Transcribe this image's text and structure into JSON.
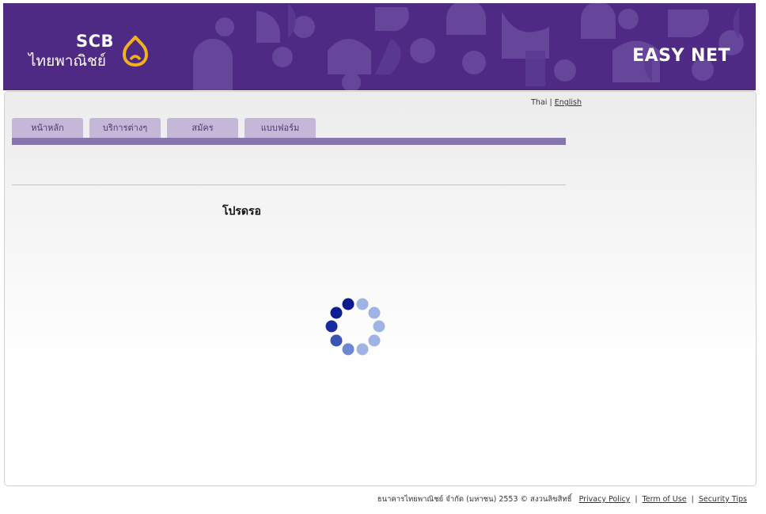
{
  "header": {
    "logo_brand": "SCB",
    "logo_name": "ไทยพาณิชย์",
    "product_name": "EASY NET",
    "banner_color": "#4e2a84"
  },
  "language": {
    "thai": "Thai",
    "separator": "|",
    "english": "English"
  },
  "nav": {
    "tabs": [
      {
        "label": "หน้าหลัก"
      },
      {
        "label": "บริการต่างๆ"
      },
      {
        "label": "สมัคร"
      },
      {
        "label": "แบบฟอร์ม"
      }
    ],
    "tab_color": "#c4b7d8",
    "bar_color": "#8975ad"
  },
  "main": {
    "wait_text": "โปรดรอ",
    "spinner_icon": "loading-spinner-icon"
  },
  "footer": {
    "copyright": "ธนาคารไทยพาณิชย์ จำกัด (มหาชน) 2553 © สงวนลิขสิทธิ์",
    "links": [
      {
        "label": "Privacy Policy"
      },
      {
        "label": "Term of Use"
      },
      {
        "label": "Security Tips"
      }
    ],
    "separator": "|"
  }
}
